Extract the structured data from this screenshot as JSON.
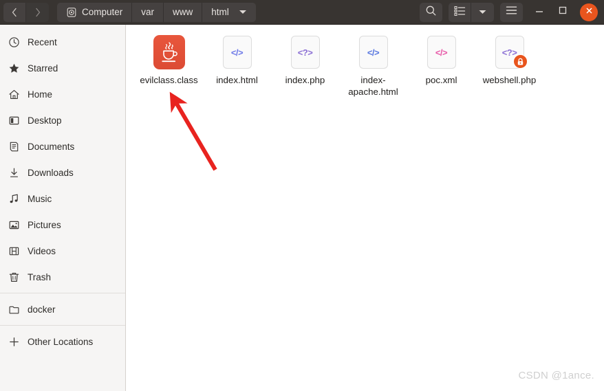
{
  "window": {
    "headerbar_color": "#383431",
    "close_button_color": "#e9551e",
    "nav": {
      "back_label": "Back",
      "forward_label": "Forward",
      "back_icon": "chevron-left-icon",
      "forward_icon": "chevron-right-icon"
    },
    "controls": {
      "minimize_label": "Minimize",
      "maximize_label": "Maximize",
      "close_label": "Close"
    }
  },
  "breadcrumb": {
    "items": [
      {
        "label": "Computer",
        "icon": "hard-disk-icon"
      },
      {
        "label": "var",
        "icon": ""
      },
      {
        "label": "www",
        "icon": ""
      },
      {
        "label": "html",
        "icon": "chevron-down-icon"
      }
    ]
  },
  "toolbar": {
    "search_label": "Search",
    "search_icon": "search-icon",
    "view_list_label": "View options",
    "view_list_icon": "list-view-icon",
    "view_dropdown_icon": "chevron-down-icon",
    "menu_label": "Menu",
    "menu_icon": "hamburger-menu-icon"
  },
  "sidebar": {
    "groups": [
      {
        "items": [
          {
            "label": "Recent",
            "icon": "clock-icon"
          },
          {
            "label": "Starred",
            "icon": "star-icon"
          },
          {
            "label": "Home",
            "icon": "home-icon"
          },
          {
            "label": "Desktop",
            "icon": "desktop-icon"
          },
          {
            "label": "Documents",
            "icon": "documents-icon"
          },
          {
            "label": "Downloads",
            "icon": "download-icon"
          },
          {
            "label": "Music",
            "icon": "music-note-icon"
          },
          {
            "label": "Pictures",
            "icon": "picture-icon"
          },
          {
            "label": "Videos",
            "icon": "film-icon"
          },
          {
            "label": "Trash",
            "icon": "trash-icon"
          }
        ]
      },
      {
        "items": [
          {
            "label": "docker",
            "icon": "folder-icon"
          }
        ]
      },
      {
        "items": [
          {
            "label": "Other Locations",
            "icon": "plus-icon"
          }
        ]
      }
    ]
  },
  "files": [
    {
      "name": "evilclass.class",
      "icon": "java-class-icon",
      "glyph": "",
      "glyph_color": "#ffffff",
      "locked": false
    },
    {
      "name": "index.html",
      "icon": "html-file-icon",
      "glyph": "</>",
      "glyph_color": "#6e7ae8",
      "locked": false
    },
    {
      "name": "index.php",
      "icon": "php-file-icon",
      "glyph": "<?>",
      "glyph_color": "#8b6fd4",
      "locked": false
    },
    {
      "name": "index-apache.html",
      "icon": "html-file-icon",
      "glyph": "</>",
      "glyph_color": "#5a78e0",
      "locked": false
    },
    {
      "name": "poc.xml",
      "icon": "xml-file-icon",
      "glyph": "</>",
      "glyph_color": "#e85aa8",
      "locked": false
    },
    {
      "name": "webshell.php",
      "icon": "php-file-icon",
      "glyph": "<?>",
      "glyph_color": "#8b6fd4",
      "locked": true
    }
  ],
  "annotation": {
    "arrow_color": "#e8231f",
    "arrow_label": "red-pointer-arrow"
  },
  "watermark": {
    "text": "CSDN @1ance."
  }
}
